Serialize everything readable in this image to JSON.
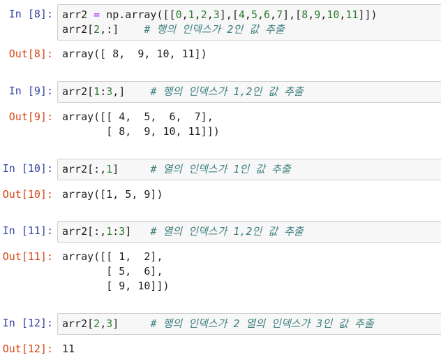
{
  "cells": [
    {
      "in_prompt": "In [8]:",
      "out_prompt": "Out[8]:",
      "code_lines": [
        [
          {
            "t": "arr2 ",
            "c": ""
          },
          {
            "t": "=",
            "c": "op"
          },
          {
            "t": " np.array([[",
            "c": ""
          },
          {
            "t": "0",
            "c": "num"
          },
          {
            "t": ",",
            "c": ""
          },
          {
            "t": "1",
            "c": "num"
          },
          {
            "t": ",",
            "c": ""
          },
          {
            "t": "2",
            "c": "num"
          },
          {
            "t": ",",
            "c": ""
          },
          {
            "t": "3",
            "c": "num"
          },
          {
            "t": "],[",
            "c": ""
          },
          {
            "t": "4",
            "c": "num"
          },
          {
            "t": ",",
            "c": ""
          },
          {
            "t": "5",
            "c": "num"
          },
          {
            "t": ",",
            "c": ""
          },
          {
            "t": "6",
            "c": "num"
          },
          {
            "t": ",",
            "c": ""
          },
          {
            "t": "7",
            "c": "num"
          },
          {
            "t": "],[",
            "c": ""
          },
          {
            "t": "8",
            "c": "num"
          },
          {
            "t": ",",
            "c": ""
          },
          {
            "t": "9",
            "c": "num"
          },
          {
            "t": ",",
            "c": ""
          },
          {
            "t": "10",
            "c": "num"
          },
          {
            "t": ",",
            "c": ""
          },
          {
            "t": "11",
            "c": "num"
          },
          {
            "t": "]])",
            "c": ""
          }
        ],
        [
          {
            "t": "arr2[",
            "c": ""
          },
          {
            "t": "2",
            "c": "num"
          },
          {
            "t": ",:]    ",
            "c": ""
          },
          {
            "t": "# 행의 인덱스가 2인 값 추출",
            "c": "cmt"
          }
        ]
      ],
      "output_lines": [
        "array([ 8,  9, 10, 11])"
      ]
    },
    {
      "in_prompt": "In [9]:",
      "out_prompt": "Out[9]:",
      "code_lines": [
        [
          {
            "t": "arr2[",
            "c": ""
          },
          {
            "t": "1",
            "c": "num"
          },
          {
            "t": ":",
            "c": ""
          },
          {
            "t": "3",
            "c": "num"
          },
          {
            "t": ",]    ",
            "c": ""
          },
          {
            "t": "# 행의 인덱스가 1,2인 값 추출",
            "c": "cmt"
          }
        ]
      ],
      "output_lines": [
        "array([[ 4,  5,  6,  7],",
        "       [ 8,  9, 10, 11]])"
      ]
    },
    {
      "in_prompt": "In [10]:",
      "out_prompt": "Out[10]:",
      "code_lines": [
        [
          {
            "t": "arr2[:,",
            "c": ""
          },
          {
            "t": "1",
            "c": "num"
          },
          {
            "t": "]     ",
            "c": ""
          },
          {
            "t": "# 열의 인덱스가 1인 값 추출",
            "c": "cmt"
          }
        ]
      ],
      "output_lines": [
        "array([1, 5, 9])"
      ]
    },
    {
      "in_prompt": "In [11]:",
      "out_prompt": "Out[11]:",
      "code_lines": [
        [
          {
            "t": "arr2[:,",
            "c": ""
          },
          {
            "t": "1",
            "c": "num"
          },
          {
            "t": ":",
            "c": ""
          },
          {
            "t": "3",
            "c": "num"
          },
          {
            "t": "]   ",
            "c": ""
          },
          {
            "t": "# 열의 인덱스가 1,2인 값 추출",
            "c": "cmt"
          }
        ]
      ],
      "output_lines": [
        "array([[ 1,  2],",
        "       [ 5,  6],",
        "       [ 9, 10]])"
      ]
    },
    {
      "in_prompt": "In [12]:",
      "out_prompt": "Out[12]:",
      "code_lines": [
        [
          {
            "t": "arr2[",
            "c": ""
          },
          {
            "t": "2",
            "c": "num"
          },
          {
            "t": ",",
            "c": ""
          },
          {
            "t": "3",
            "c": "num"
          },
          {
            "t": "]     ",
            "c": ""
          },
          {
            "t": "# 행의 인덱스가 2 열의 인덱스가 3인 값 추출",
            "c": "cmt"
          }
        ]
      ],
      "output_lines": [
        "11"
      ]
    }
  ],
  "colors": {
    "in_prompt": "#303f9f",
    "out_prompt": "#d84315",
    "number": "#2e7d32",
    "operator": "#aa22ff",
    "comment": "#408080",
    "input_bg": "#f7f7f7",
    "input_border": "#cfcfcf"
  }
}
